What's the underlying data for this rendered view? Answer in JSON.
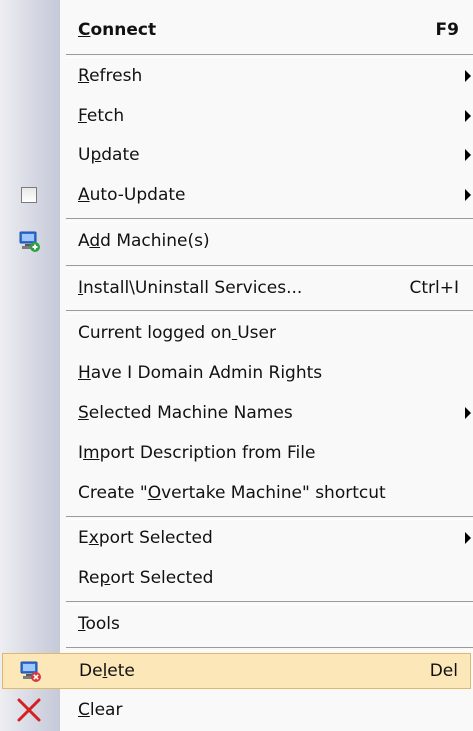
{
  "menu": {
    "items": [
      {
        "label": "Connect",
        "mnemonic": 0,
        "shortcut": "F9",
        "bold": true
      },
      {
        "label": "Refresh",
        "mnemonic": 0,
        "submenu": true
      },
      {
        "label": "Fetch",
        "mnemonic": 0,
        "submenu": true
      },
      {
        "label": "Update",
        "mnemonic": 1,
        "submenu": true
      },
      {
        "label": "Auto-Update",
        "mnemonic": 0,
        "submenu": true,
        "icon": "checkbox-icon"
      },
      {
        "label": "Add Machine(s)",
        "mnemonic": 1,
        "icon": "add-machine-icon"
      },
      {
        "label": "Install\\Uninstall Services...",
        "mnemonic": 0,
        "shortcut": "Ctrl+I"
      },
      {
        "label": "Current logged on User",
        "mnemonic": 17
      },
      {
        "label": "Have I Domain Admin Rights",
        "mnemonic": 0
      },
      {
        "label": "Selected Machine Names",
        "mnemonic": 0,
        "submenu": true
      },
      {
        "label": "Import Description from File",
        "mnemonic": 1
      },
      {
        "label": "Create \"Overtake Machine\" shortcut",
        "mnemonic": 8
      },
      {
        "label": "Export Selected",
        "mnemonic": 1,
        "submenu": true
      },
      {
        "label": "Report Selected",
        "mnemonic": 2
      },
      {
        "label": "Tools",
        "mnemonic": 0
      },
      {
        "label": "Delete",
        "mnemonic": 2,
        "shortcut": "Del",
        "icon": "delete-machine-icon",
        "highlighted": true
      },
      {
        "label": "Clear",
        "mnemonic": 0,
        "icon": "clear-x-icon"
      }
    ]
  },
  "colors": {
    "highlight_bg": "#fbe7b8",
    "highlight_border": "#e1b76a",
    "clear_x": "#d42020",
    "machine_blue": "#2f6fd6"
  }
}
